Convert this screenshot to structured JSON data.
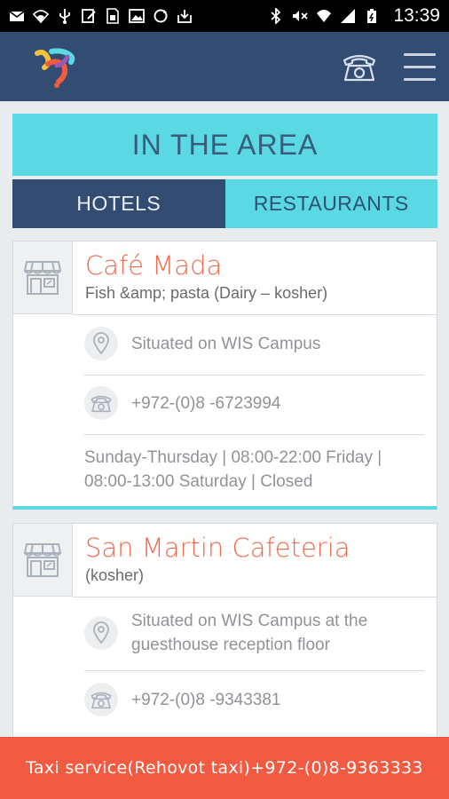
{
  "status_bar": {
    "time": "13:39",
    "icons": [
      "mail-icon",
      "wifi-icon",
      "usb-icon",
      "edit-icon",
      "sim-icon",
      "image-icon",
      "sync-icon",
      "download-icon",
      "bluetooth-icon",
      "mute-icon",
      "wifi-signal-icon",
      "cell-signal-icon",
      "battery-icon"
    ]
  },
  "header": {
    "logo_icon": "app-logo-icon",
    "phone_icon": "phone-icon",
    "menu_icon": "hamburger-menu-icon"
  },
  "page": {
    "title": "IN THE AREA",
    "tabs": [
      {
        "label": "HOTELS",
        "active": true
      },
      {
        "label": "RESTAURANTS",
        "active": false
      }
    ]
  },
  "cards": [
    {
      "name": "Café Mada",
      "subtitle": "Fish &amp; pasta (Dairy – kosher)",
      "location": "Situated on WIS Campus",
      "phone": "+972-(0)8 -6723994",
      "hours": "Sunday-Thursday | 08:00-22:00  Friday | 08:00-13:00  Saturday | Closed"
    },
    {
      "name": "San Martin Cafeteria",
      "subtitle": "(kosher)",
      "location": "Situated on WIS Campus at the guesthouse reception floor",
      "phone": "+972-(0)8 -9343381"
    }
  ],
  "footer": {
    "taxi_text": "Taxi service(Rehovot taxi)+972-(0)8-9363333"
  },
  "colors": {
    "header": "#334c72",
    "accent": "#5ad9e4",
    "title_red": "#f06a4f",
    "taxi_bar": "#f25a41"
  }
}
